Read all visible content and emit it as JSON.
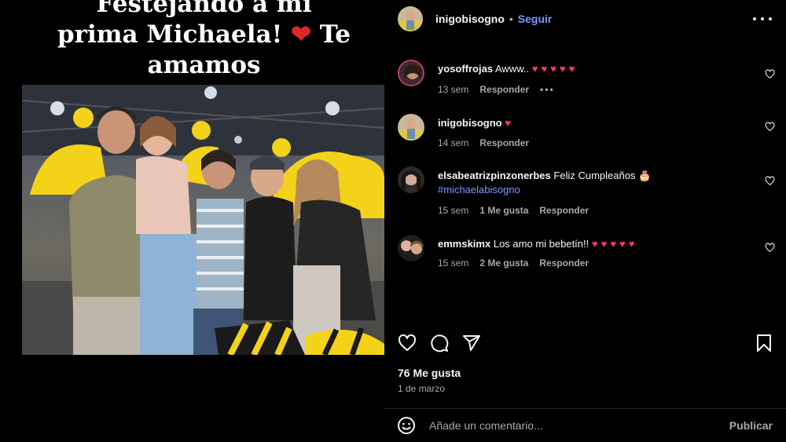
{
  "media": {
    "overlay_text_line1": "Festejando a mi",
    "overlay_text_line2": "prima Michaela!",
    "overlay_heart": "❤",
    "overlay_text_line2b": "Te",
    "overlay_text_line3": "amamos"
  },
  "header": {
    "username": "inigobisogno",
    "separator": "•",
    "follow_label": "Seguir"
  },
  "comments": [
    {
      "username": "yosoffrojas",
      "text": "Awww..",
      "hearts": "♥♥♥♥♥",
      "time": "13 sem",
      "likes": "",
      "reply": "Responder",
      "more": "•••"
    },
    {
      "username": "inigobisogno",
      "text": "",
      "hearts": "♥",
      "time": "14 sem",
      "likes": "",
      "reply": "Responder"
    },
    {
      "username": "elsabeatrizpinzonerbes",
      "text": "Feliz Cumpleaños",
      "emoji": "🎂",
      "hashtag": "#michaelabisogno",
      "time": "15 sem",
      "likes": "1 Me gusta",
      "reply": "Responder"
    },
    {
      "username": "emmskimx",
      "text": "Los amo mi bebetín!!",
      "hearts": "♥♥♥♥♥",
      "time": "15 sem",
      "likes": "2 Me gusta",
      "reply": "Responder"
    }
  ],
  "actions": {
    "icons": [
      "heart-icon",
      "comment-icon",
      "share-icon",
      "bookmark-icon"
    ]
  },
  "likes_count": "76 Me gusta",
  "post_date": "1 de marzo",
  "comment_box": {
    "placeholder": "Añade un comentario...",
    "publish_label": "Publicar"
  },
  "colors": {
    "background": "#000000",
    "link": "#7f95ff",
    "heart": "#ff3568",
    "muted": "#a8a8a8"
  }
}
